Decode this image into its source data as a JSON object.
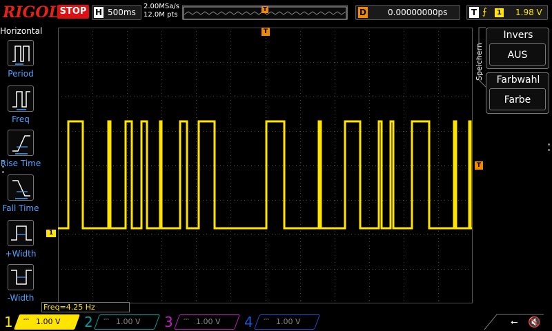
{
  "topbar": {
    "brand": "RIGOL",
    "run_state": "STOP",
    "horizontal_label": "H",
    "timebase": "500ms",
    "sample_rate": "2.00MSa/s",
    "memory_points": "12.0M pts",
    "delay_label": "D",
    "delay_value": "0.00000000ps",
    "trigger_label": "T",
    "trigger_edge": "⨍",
    "trigger_source": "1",
    "trigger_level": "1.98 V",
    "trigger_marker": "T"
  },
  "left_menu": {
    "title": "Horizontal",
    "items": [
      {
        "label": "Period",
        "icon": "period-icon"
      },
      {
        "label": "Freq",
        "icon": "frequency-icon"
      },
      {
        "label": "Rise Time",
        "icon": "rise-time-icon"
      },
      {
        "label": "Fall Time",
        "icon": "fall-time-icon"
      },
      {
        "label": "+Width",
        "icon": "positive-width-icon"
      },
      {
        "label": "-Width",
        "icon": "negative-width-icon"
      }
    ]
  },
  "right_menu": {
    "title": "Speichern",
    "items": [
      {
        "label": "Invers",
        "value": "AUS"
      },
      {
        "label": "Farbwahl",
        "value": "Farbe"
      }
    ]
  },
  "screen": {
    "ch1_marker": "1",
    "trigger_pos_marker": "T",
    "trigger_level_marker": "T",
    "measurement": "Freq=4.25 Hz"
  },
  "channels": [
    {
      "number": "1",
      "scale": "1.00 V",
      "color": "#ffe400",
      "active": true
    },
    {
      "number": "2",
      "scale": "1.00 V",
      "color": "#00a0a0",
      "active": false
    },
    {
      "number": "3",
      "scale": "1.00 V",
      "color": "#c020c0",
      "active": false
    },
    {
      "number": "4",
      "scale": "1.00 V",
      "color": "#2050d0",
      "active": false
    }
  ],
  "status_icons": [
    "usb-icon",
    "speaker-muted-icon"
  ],
  "waveform": {
    "color": "#ffe400",
    "high_pulses": [
      [
        99,
        120
      ],
      [
        157,
        160
      ],
      [
        182,
        191
      ],
      [
        205,
        213
      ],
      [
        232,
        234
      ],
      [
        261,
        271
      ],
      [
        288,
        311
      ],
      [
        386,
        412
      ],
      [
        462,
        465
      ],
      [
        500,
        522
      ],
      [
        549,
        553
      ],
      [
        566,
        570
      ],
      [
        597,
        622
      ],
      [
        658,
        661
      ],
      [
        680,
        682
      ]
    ]
  }
}
